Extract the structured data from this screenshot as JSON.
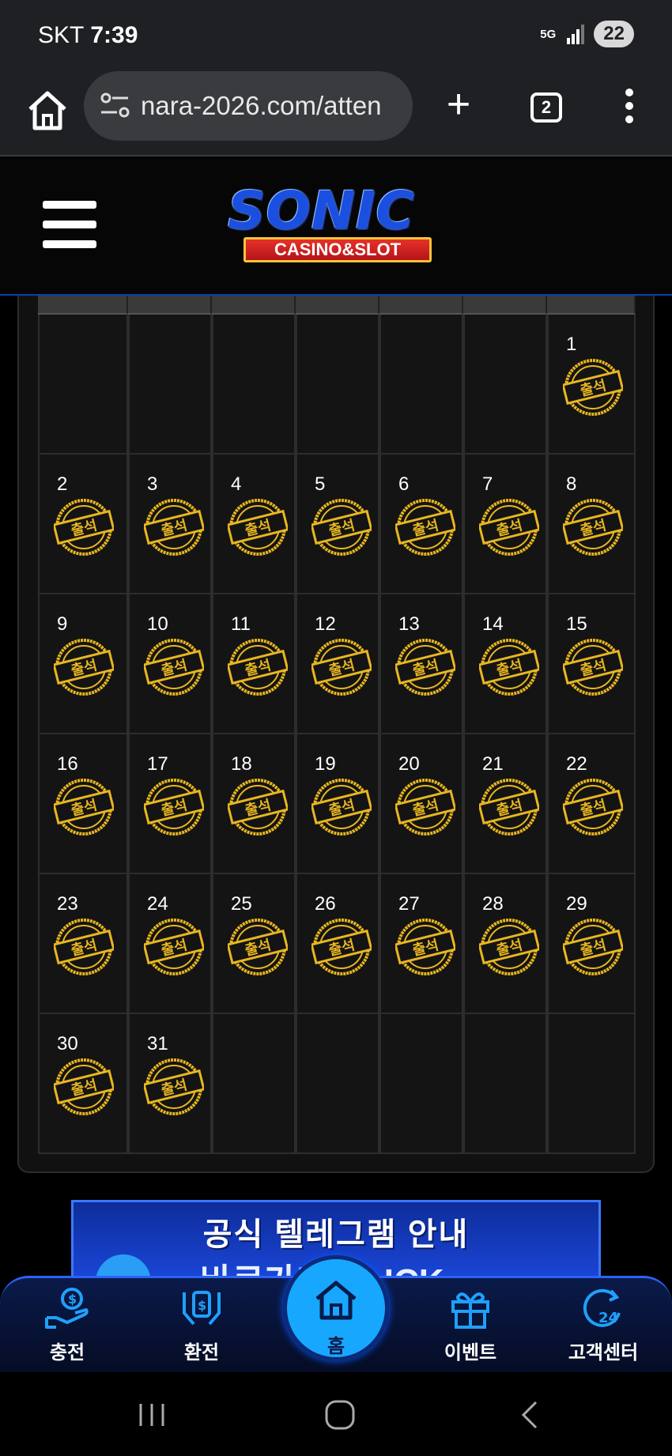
{
  "status_bar": {
    "carrier": "SKT",
    "time": "7:39",
    "network": "5G",
    "battery": "22"
  },
  "browser": {
    "url": "nara-2026.com/atten",
    "tab_count": "2"
  },
  "site": {
    "logo_main": "SONIC",
    "logo_sub": "CASINO&SLOT"
  },
  "calendar": {
    "weeks": [
      [
        "",
        "",
        "",
        "",
        "",
        "",
        "1"
      ],
      [
        "2",
        "3",
        "4",
        "5",
        "6",
        "7",
        "8"
      ],
      [
        "9",
        "10",
        "11",
        "12",
        "13",
        "14",
        "15"
      ],
      [
        "16",
        "17",
        "18",
        "19",
        "20",
        "21",
        "22"
      ],
      [
        "23",
        "24",
        "25",
        "26",
        "27",
        "28",
        "29"
      ],
      [
        "30",
        "31",
        "",
        "",
        "",
        "",
        ""
      ]
    ],
    "stamp_label": "출석",
    "stamp_color": "#e8b620"
  },
  "banner": {
    "title": "공식 텔레그램 안내",
    "click_text": "바로가기 CLICK"
  },
  "bottom_nav": {
    "items": [
      {
        "label": "충전",
        "icon": "deposit-icon"
      },
      {
        "label": "환전",
        "icon": "withdraw-icon"
      },
      {
        "label": "홈",
        "icon": "home-icon"
      },
      {
        "label": "이벤트",
        "icon": "gift-icon"
      },
      {
        "label": "고객센터",
        "icon": "support-24-icon"
      }
    ]
  },
  "colors": {
    "accent": "#17a7ff",
    "nav_bg": "#0a1a4a",
    "stamp": "#e8b620"
  }
}
